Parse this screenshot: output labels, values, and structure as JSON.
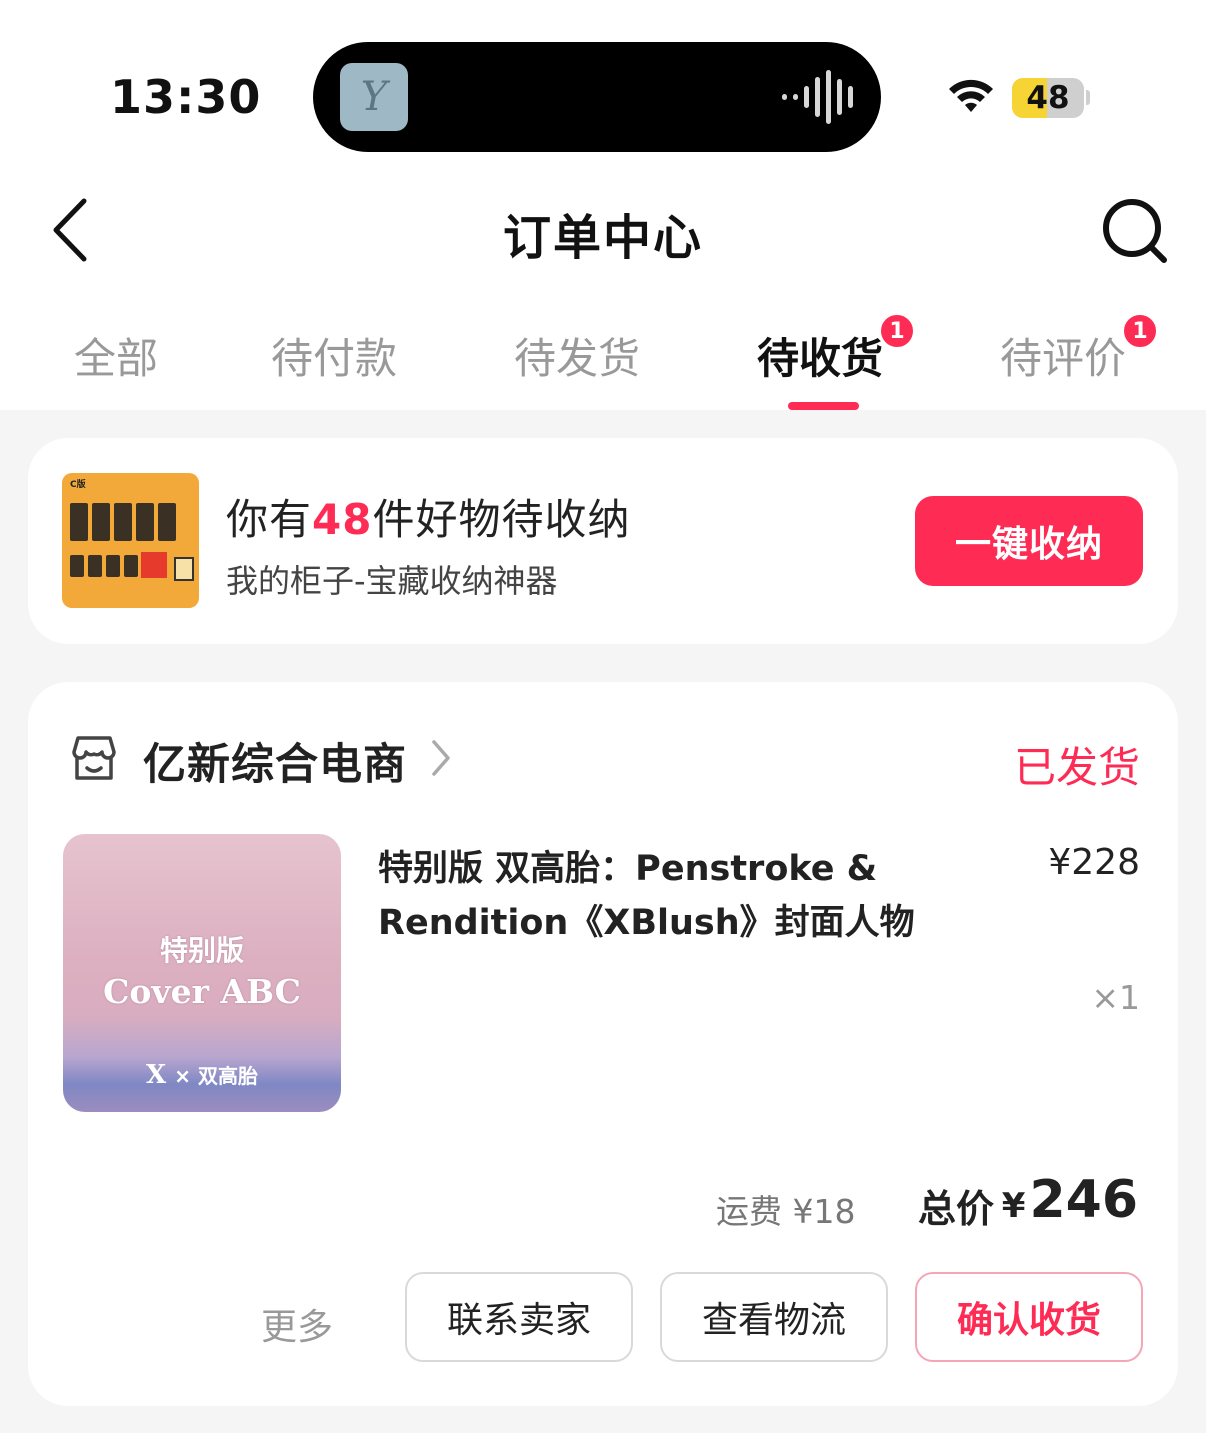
{
  "status_bar": {
    "time": "13:30",
    "battery": "48",
    "battery_level": 0.48,
    "island_avatar_text": "Y"
  },
  "nav": {
    "title": "订单中心",
    "back_icon": "chevron-left-icon",
    "search_icon": "search-icon"
  },
  "tabs": [
    {
      "label": "全部",
      "badge": "",
      "active": false
    },
    {
      "label": "待付款",
      "badge": "",
      "active": false
    },
    {
      "label": "待发货",
      "badge": "",
      "active": false
    },
    {
      "label": "待收货",
      "badge": "1",
      "active": true
    },
    {
      "label": "待评价",
      "badge": "1",
      "active": false
    }
  ],
  "promo": {
    "title_prefix": "你有",
    "title_count": "48",
    "title_suffix": "件好物待收纳",
    "subtitle": "我的柜子-宝藏收纳神器",
    "button": "一键收纳",
    "thumb_tag": "C版"
  },
  "order": {
    "store_name": "亿新综合电商",
    "status": "已发货",
    "product": {
      "image_line1": "特别版",
      "image_line2": "Cover ABC",
      "image_line3_mark": "X",
      "image_line3_text": "× 双高胎",
      "title": "特别版  双高胎：Penstroke & Rendition《XBlush》封面人物",
      "price": "¥228",
      "qty": "×1"
    },
    "shipping": "运费 ¥18",
    "total_label": "总价",
    "total_currency": "¥",
    "total_amount": "246",
    "actions": {
      "more": "更多",
      "contact": "联系卖家",
      "logistics": "查看物流",
      "confirm": "确认收货"
    }
  },
  "colors": {
    "accent": "#fe2c55",
    "battery_fill": "#f6d433"
  }
}
